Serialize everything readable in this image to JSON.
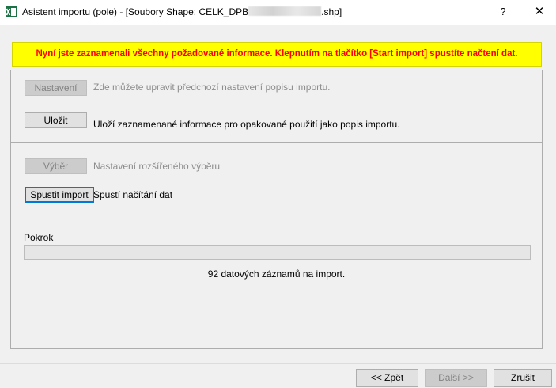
{
  "window": {
    "title_prefix": "Asistent importu (pole) - [Soubory Shape: CELK_DPB",
    "title_suffix": ".shp]",
    "help_label": "?",
    "close_label": "✕"
  },
  "banner": {
    "text": "Nyní jste zaznamenali všechny požadované informace. Klepnutím na tlačítko [Start import] spustíte načtení dat.",
    "background": "#ffff00",
    "text_color": "#ff0000"
  },
  "sections": {
    "settings": {
      "button_label": "Nastavení",
      "description": "Zde můžete upravit předchozí nastavení popisu importu."
    },
    "save": {
      "button_label": "Uložit",
      "description": "Uloží zaznamenané informace pro opakované použití jako popis importu."
    },
    "selection": {
      "button_label": "Výběr",
      "description": "Nastavení rozšířeného výběru"
    },
    "start": {
      "button_label": "Spustit import",
      "description": "Spustí načítání dat"
    }
  },
  "progress": {
    "label": "Pokrok",
    "value": 0,
    "records_text": "92 datových záznamů na import."
  },
  "footer": {
    "back_label": "<< Zpět",
    "next_label": "Další >>",
    "cancel_label": "Zrušit"
  }
}
